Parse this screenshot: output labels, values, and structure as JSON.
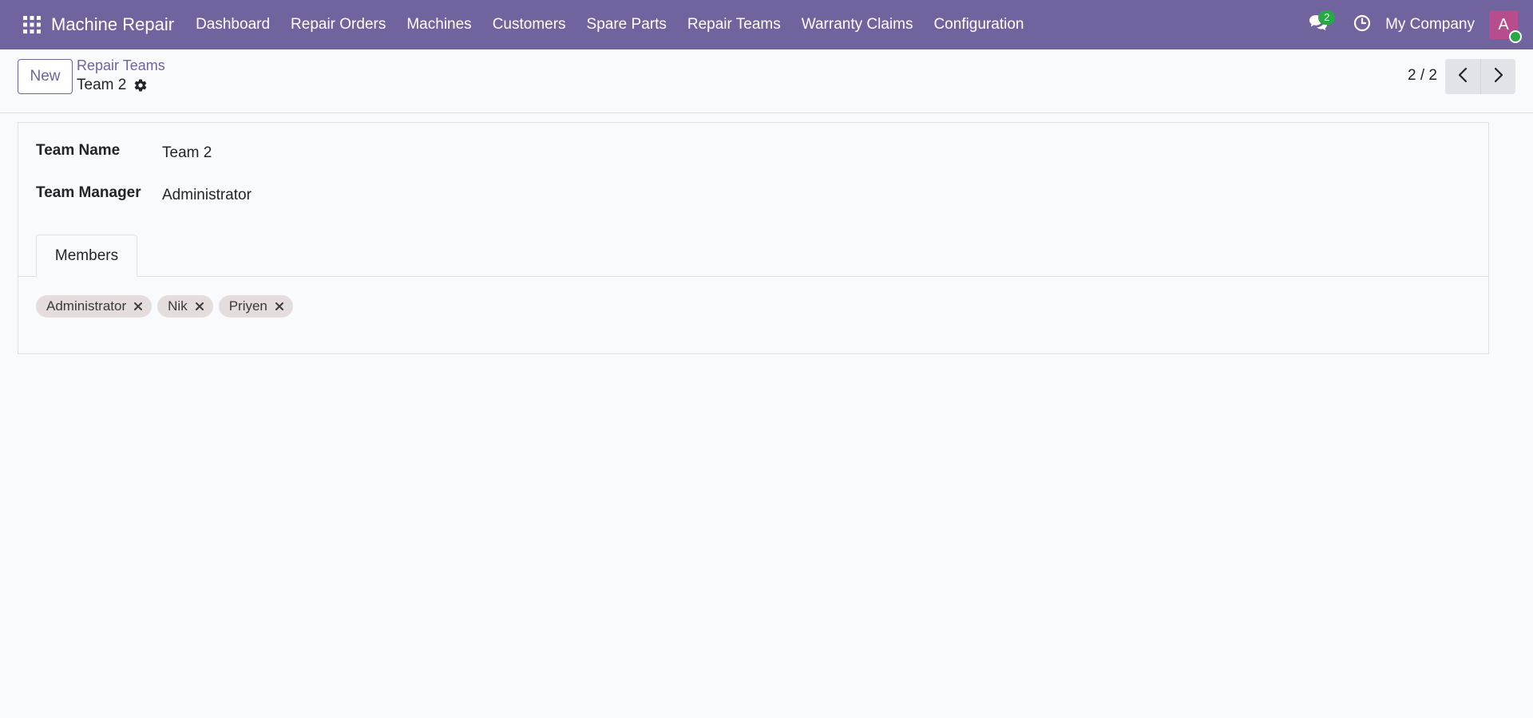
{
  "navbar": {
    "brand": "Machine Repair",
    "menu": [
      "Dashboard",
      "Repair Orders",
      "Machines",
      "Customers",
      "Spare Parts",
      "Repair Teams",
      "Warranty Claims",
      "Configuration"
    ],
    "chat_count": "2",
    "company": "My Company",
    "avatar_initial": "A",
    "bg_color": "#71639e"
  },
  "control_panel": {
    "new_label": "New",
    "breadcrumb_parent": "Repair Teams",
    "breadcrumb_current": "Team 2",
    "pager": "2 / 2"
  },
  "form": {
    "team_name_label": "Team Name",
    "team_name_value": "Team 2",
    "team_manager_label": "Team Manager",
    "team_manager_value": "Administrator",
    "tab_label": "Members",
    "members": [
      "Administrator",
      "Nik",
      "Priyen"
    ]
  },
  "icons": {
    "apps": "apps-grid-icon",
    "chat": "chat-icon",
    "clock": "clock-icon",
    "gear": "gear-icon",
    "prev": "chevron-left-icon",
    "next": "chevron-right-icon",
    "remove": "close-icon"
  }
}
